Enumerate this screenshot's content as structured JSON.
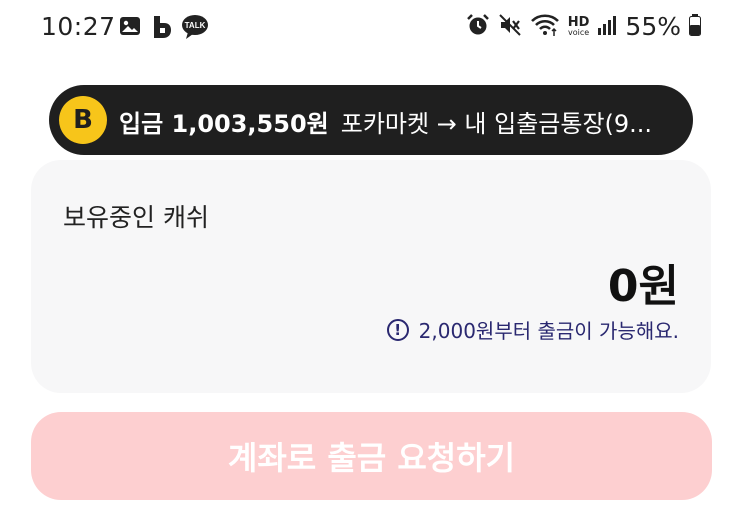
{
  "status_bar": {
    "time": "10:27",
    "battery": "55%",
    "hd_label": "HD",
    "voice_label": "voice",
    "talk_label": "TALK",
    "left_icons": [
      "image-icon",
      "b-app-icon",
      "kakaotalk-icon"
    ],
    "right_icons": [
      "alarm-icon",
      "mute-icon",
      "wifi-icon",
      "hd-voice-icon",
      "signal-icon",
      "battery-icon"
    ]
  },
  "notification": {
    "logo_letter": "B",
    "title": "입금 1,003,550원",
    "body": "포카마켓 → 내 입출금통장(9...",
    "logo_color": "#f7c51a"
  },
  "cash_card": {
    "label": "보유중인 캐쉬",
    "amount": "0원",
    "notice_icon": "!",
    "notice": "2,000원부터 출금이 가능해요."
  },
  "withdraw_button": {
    "label": "계좌로 출금 요청하기",
    "color": "#fdcfd0"
  }
}
